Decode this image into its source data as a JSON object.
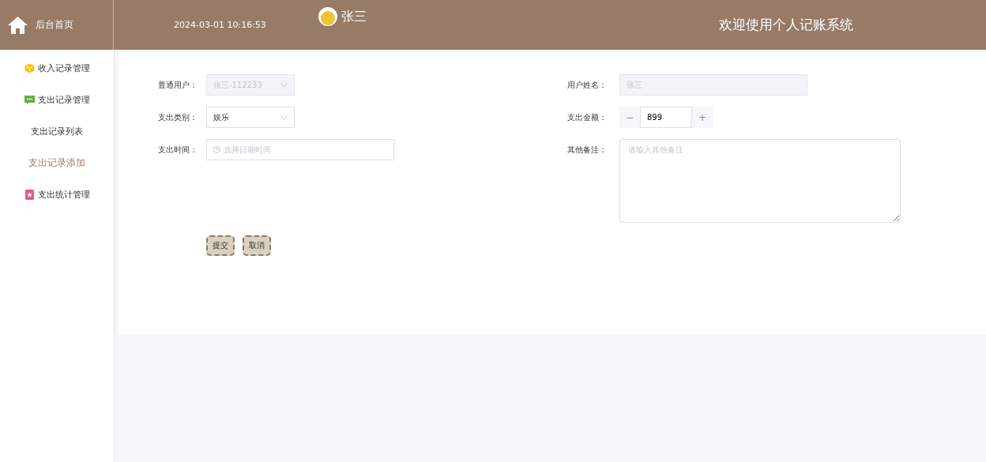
{
  "header": {
    "home_label": "后台首页",
    "datetime": "2024-03-01 10:16:53",
    "user_name": "张三",
    "welcome": "欢迎使用个人记账系统"
  },
  "sidebar": {
    "items": [
      {
        "label": "收入记录管理",
        "selected": false
      },
      {
        "label": "支出记录管理",
        "selected": false,
        "children": [
          {
            "label": "支出记录列表",
            "selected": false
          },
          {
            "label": "支出记录添加",
            "selected": true
          }
        ]
      },
      {
        "label": "支出统计管理",
        "selected": false
      }
    ]
  },
  "form": {
    "left": [
      {
        "kind": "select",
        "label": "普通用户：",
        "value": "张三-112233",
        "disabled": true
      },
      {
        "kind": "select",
        "label": "支出类别：",
        "value": "娱乐",
        "disabled": false
      },
      {
        "kind": "datetime",
        "label": "支出时间：",
        "placeholder": "选择日期时间"
      }
    ],
    "right": [
      {
        "kind": "input",
        "label": "用户姓名：",
        "value": "张三",
        "disabled": true
      },
      {
        "kind": "number",
        "label": "支出金额：",
        "value": "899",
        "minus": "−",
        "plus": "+"
      },
      {
        "kind": "textarea",
        "label": "其他备注：",
        "placeholder": "请输入其他备注"
      }
    ],
    "buttons": [
      "提交",
      "取消"
    ]
  }
}
